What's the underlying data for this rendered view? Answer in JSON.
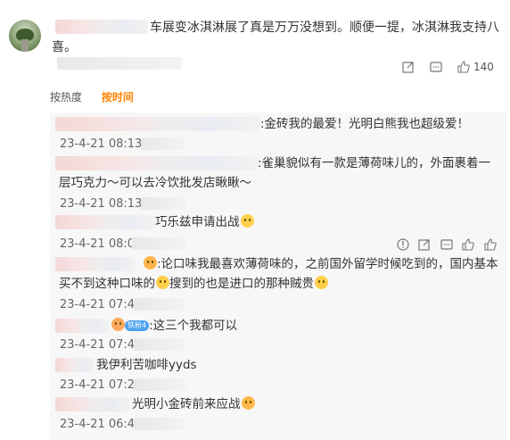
{
  "main_comment": {
    "text_line1": "车展变冰淇淋展了真是万万没想到。顺便一提，冰淇淋我支持八",
    "text_line2": "喜。",
    "like_count": "140"
  },
  "sort": {
    "hot": "按热度",
    "time": "按时间"
  },
  "replies": [
    {
      "text": ":金砖我的最爱！光明白熊我也超级爱！",
      "time": "23-4-21 08:13"
    },
    {
      "text": ":雀巢貌似有一款是薄荷味儿的，外面裹着一",
      "text2": "层巧克力～可以去冷饮批发店瞅瞅～",
      "time": "23-4-21 08:13"
    },
    {
      "text": "巧乐兹申请出战",
      "time": "23-4-21 08:0"
    },
    {
      "text": ":论口味我最喜欢薄荷味的，之前国外留学时候吃到的，国内基本",
      "text2a": "买不到这种口味的",
      "text2b": "搜到的也是进口的那种贼贵",
      "time": "23-4-21 07:49"
    },
    {
      "text": ":这三个我都可以",
      "badge": "铁粉4",
      "time": "23-4-21 07:45"
    },
    {
      "text": "我伊利苦咖啡yyds",
      "time": "23-4-21 07:24"
    },
    {
      "text": "光明小金砖前来应战",
      "time": "23-4-21 06:49"
    }
  ],
  "icons": [
    "share-icon",
    "comment-icon",
    "like-icon",
    "more-icon"
  ]
}
